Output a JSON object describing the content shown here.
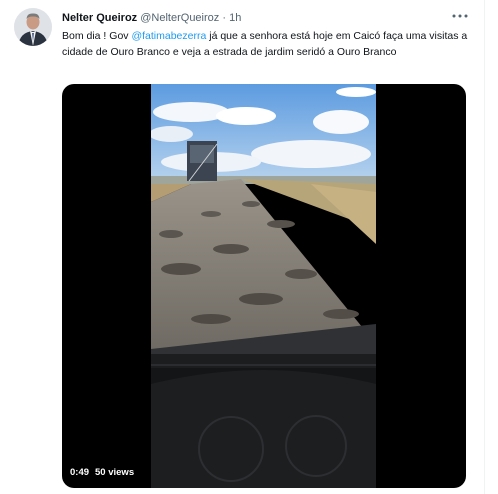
{
  "tweet": {
    "author_name": "Nelter Queiroz",
    "handle": "@NelterQueiroz",
    "separator": "·",
    "time": "1h",
    "more_icon": "more-horizontal-icon",
    "text_part1": "Bom dia ! Gov ",
    "mention": "@fatimabezerra",
    "text_part2": " já que a senhora está hoje em Caicó faça uma visitas a cidade de Ouro Branco e veja a estrada de jardim seridó a Ouro Branco"
  },
  "video": {
    "duration": "0:49",
    "views": "50 views"
  },
  "colors": {
    "accent": "#1d9bf0",
    "text": "#0f1419",
    "secondary": "#536471"
  }
}
